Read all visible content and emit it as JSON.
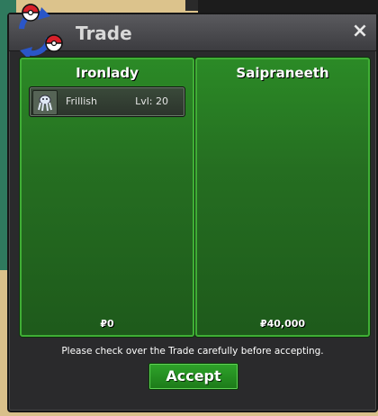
{
  "window": {
    "title": "Trade",
    "close_label": "×"
  },
  "left_panel": {
    "player_name": "Ironlady",
    "money": "₽0",
    "items": [
      {
        "name": "Frillish",
        "level": "Lvl: 20",
        "icon": "frillish-sprite-icon"
      }
    ]
  },
  "right_panel": {
    "player_name": "Saipraneeth",
    "money": "₽40,000"
  },
  "notice": "Please check over the Trade carefully before accepting.",
  "accept_label": "Accept",
  "colors": {
    "panel_green": "#256e21",
    "panel_border": "#3fae35",
    "accept_green": "#2fa42a",
    "window_bg": "#2a2a2c"
  }
}
